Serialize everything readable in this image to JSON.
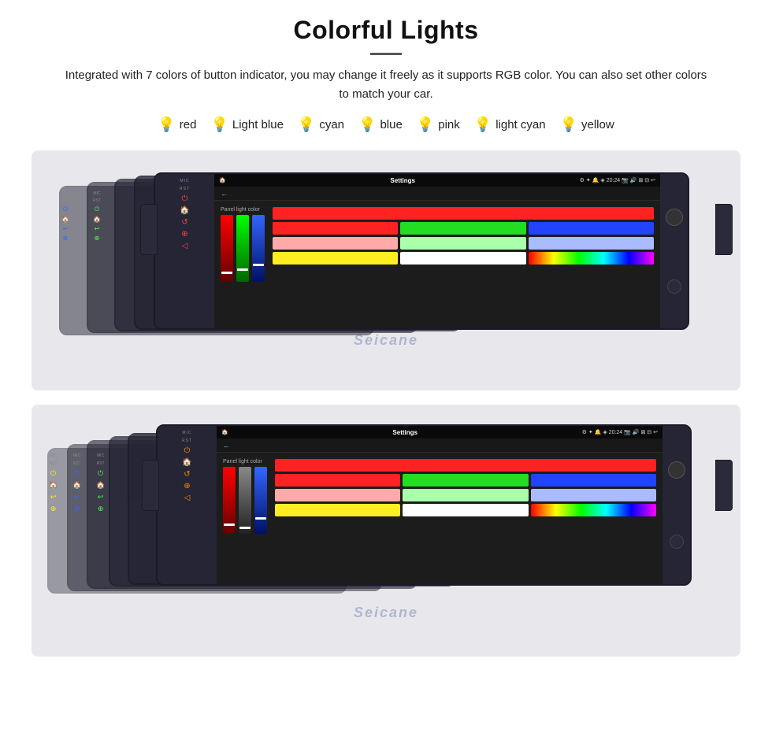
{
  "page": {
    "title": "Colorful Lights",
    "description": "Integrated with 7 colors of button indicator, you may change it freely as it supports RGB color. You can also set other colors to match your car.",
    "divider": "—"
  },
  "colors": [
    {
      "name": "red",
      "emoji": "🔴",
      "hex": "#ff2222"
    },
    {
      "name": "Light blue",
      "emoji": "💙",
      "hex": "#aaddff"
    },
    {
      "name": "cyan",
      "emoji": "💚",
      "hex": "#00ffff"
    },
    {
      "name": "blue",
      "emoji": "🔵",
      "hex": "#2255ff"
    },
    {
      "name": "pink",
      "emoji": "🩷",
      "hex": "#ff44bb"
    },
    {
      "name": "light cyan",
      "emoji": "💙",
      "hex": "#88eeff"
    },
    {
      "name": "yellow",
      "emoji": "💛",
      "hex": "#ffee22"
    }
  ],
  "device": {
    "settings_title": "Settings",
    "panel_light_label": "Panel light color",
    "time": "20:24",
    "watermark": "Seicane"
  }
}
